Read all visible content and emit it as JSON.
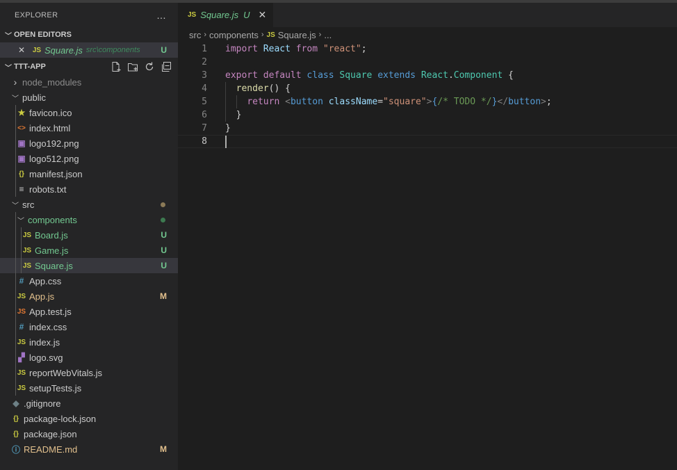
{
  "colors": {
    "untracked": "#73c991",
    "modified": "#e2c08d",
    "js_icon": "#cbcb41",
    "css_icon": "#519aba",
    "html_icon": "#e37933",
    "json_icon": "#cbcb41",
    "image_icon": "#a074c4",
    "info_icon": "#519aba"
  },
  "sidebar": {
    "title": "EXPLORER",
    "more_icon": "…",
    "open_editors": {
      "label": "OPEN EDITORS",
      "items": [
        {
          "icon": "JS",
          "name": "Square.js",
          "path": "src\\components",
          "decoration": "U"
        }
      ]
    },
    "project": {
      "label": "TTT-APP",
      "actions": [
        "new-file-icon",
        "new-folder-icon",
        "refresh-icon",
        "collapse-all-icon"
      ],
      "tree": [
        {
          "label": "node_modules",
          "type": "folder",
          "expanded": false,
          "depth": 0
        },
        {
          "label": "public",
          "type": "folder",
          "expanded": true,
          "depth": 0
        },
        {
          "label": "favicon.ico",
          "icon": "★",
          "iconColor": "#cbcb41",
          "depth": 1
        },
        {
          "label": "index.html",
          "icon": "<>",
          "iconColor": "#e37933",
          "depth": 1
        },
        {
          "label": "logo192.png",
          "icon": "▣",
          "iconColor": "#a074c4",
          "depth": 1
        },
        {
          "label": "logo512.png",
          "icon": "▣",
          "iconColor": "#a074c4",
          "depth": 1
        },
        {
          "label": "manifest.json",
          "icon": "{}",
          "iconColor": "#cbcb41",
          "depth": 1
        },
        {
          "label": "robots.txt",
          "icon": "≡",
          "iconColor": "#cccccc",
          "depth": 1
        },
        {
          "label": "src",
          "type": "folder",
          "expanded": true,
          "depth": 0,
          "dot": "#8b7a57"
        },
        {
          "label": "components",
          "type": "folder",
          "expanded": true,
          "depth": 1,
          "color": "#73c991",
          "dot": "#3d7a50"
        },
        {
          "label": "Board.js",
          "icon": "JS",
          "iconColor": "#cbcb41",
          "depth": 2,
          "color": "#73c991",
          "decoration": "U"
        },
        {
          "label": "Game.js",
          "icon": "JS",
          "iconColor": "#cbcb41",
          "depth": 2,
          "color": "#73c991",
          "decoration": "U"
        },
        {
          "label": "Square.js",
          "icon": "JS",
          "iconColor": "#cbcb41",
          "depth": 2,
          "color": "#73c991",
          "decoration": "U",
          "selected": true
        },
        {
          "label": "App.css",
          "icon": "#",
          "iconColor": "#519aba",
          "depth": 1
        },
        {
          "label": "App.js",
          "icon": "JS",
          "iconColor": "#cbcb41",
          "depth": 1,
          "color": "#e2c08d",
          "decoration": "M"
        },
        {
          "label": "App.test.js",
          "icon": "JS",
          "iconColor": "#e37933",
          "depth": 1
        },
        {
          "label": "index.css",
          "icon": "#",
          "iconColor": "#519aba",
          "depth": 1
        },
        {
          "label": "index.js",
          "icon": "JS",
          "iconColor": "#cbcb41",
          "depth": 1
        },
        {
          "label": "logo.svg",
          "icon": "▞",
          "iconColor": "#a074c4",
          "depth": 1
        },
        {
          "label": "reportWebVitals.js",
          "icon": "JS",
          "iconColor": "#cbcb41",
          "depth": 1
        },
        {
          "label": "setupTests.js",
          "icon": "JS",
          "iconColor": "#cbcb41",
          "depth": 1
        },
        {
          "label": ".gitignore",
          "icon": "◆",
          "iconColor": "#6d8086",
          "depth": 0
        },
        {
          "label": "package-lock.json",
          "icon": "{}",
          "iconColor": "#cbcb41",
          "depth": 0
        },
        {
          "label": "package.json",
          "icon": "{}",
          "iconColor": "#cbcb41",
          "depth": 0
        },
        {
          "label": "README.md",
          "icon": "ⓘ",
          "iconColor": "#519aba",
          "depth": 0,
          "color": "#e2c08d",
          "decoration": "M"
        }
      ]
    }
  },
  "editor": {
    "tab": {
      "icon": "JS",
      "name": "Square.js",
      "decoration": "U",
      "close": "✕"
    },
    "breadcrumbs": {
      "parts": [
        "src",
        "components"
      ],
      "file_icon": "JS",
      "file": "Square.js",
      "more": "..."
    },
    "active_line": 8,
    "lines": [
      [
        [
          "kw",
          "import"
        ],
        [
          "pu",
          " "
        ],
        [
          "va",
          "React"
        ],
        [
          "pu",
          " "
        ],
        [
          "kw",
          "from"
        ],
        [
          "pu",
          " "
        ],
        [
          "str",
          "\"react\""
        ],
        [
          "pu",
          ";"
        ]
      ],
      [],
      [
        [
          "kw",
          "export"
        ],
        [
          "pu",
          " "
        ],
        [
          "kw",
          "default"
        ],
        [
          "pu",
          " "
        ],
        [
          "st",
          "class"
        ],
        [
          "pu",
          " "
        ],
        [
          "ty",
          "Square"
        ],
        [
          "pu",
          " "
        ],
        [
          "st",
          "extends"
        ],
        [
          "pu",
          " "
        ],
        [
          "ty",
          "React"
        ],
        [
          "pu",
          "."
        ],
        [
          "ty",
          "Component"
        ],
        [
          "pu",
          " {"
        ]
      ],
      [
        [
          "pu",
          "  "
        ],
        [
          "fn",
          "render"
        ],
        [
          "pu",
          "() {"
        ]
      ],
      [
        [
          "pu",
          "    "
        ],
        [
          "kw",
          "return"
        ],
        [
          "pu",
          " "
        ],
        [
          "tg",
          "<"
        ],
        [
          "st",
          "button"
        ],
        [
          "pu",
          " "
        ],
        [
          "va",
          "className"
        ],
        [
          "pu",
          "="
        ],
        [
          "str",
          "\"square\""
        ],
        [
          "tg",
          ">"
        ],
        [
          "st",
          "{"
        ],
        [
          "cm",
          "/* TODO */"
        ],
        [
          "st",
          "}"
        ],
        [
          "tg",
          "</"
        ],
        [
          "st",
          "button"
        ],
        [
          "tg",
          ">"
        ],
        [
          "pu",
          ";"
        ]
      ],
      [
        [
          "pu",
          "  }"
        ]
      ],
      [
        [
          "pu",
          "}"
        ]
      ],
      []
    ]
  }
}
